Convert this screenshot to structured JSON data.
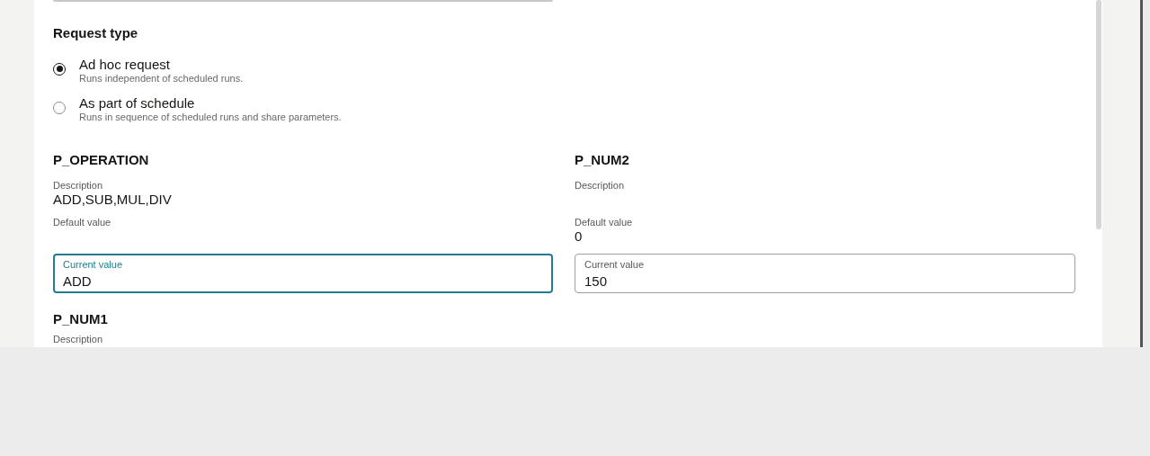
{
  "request_type": {
    "title": "Request type",
    "options": [
      {
        "label": "Ad hoc request",
        "hint": "Runs independent of scheduled runs.",
        "selected": true
      },
      {
        "label": "As part of schedule",
        "hint": "Runs in sequence of scheduled runs and share parameters.",
        "selected": false
      }
    ]
  },
  "parameters": [
    {
      "name": "P_OPERATION",
      "description_label": "Description",
      "description": "ADD,SUB,MUL,DIV",
      "default_label": "Default value",
      "current_label": "Current value",
      "current_value": "ADD",
      "focused": true
    },
    {
      "name": "P_NUM2",
      "description_label": "Description",
      "default_label": "Default value",
      "default_value": "0",
      "current_label": "Current value",
      "current_value": "150",
      "focused": false
    },
    {
      "name": "P_NUM1",
      "description_label": "Description"
    }
  ]
}
